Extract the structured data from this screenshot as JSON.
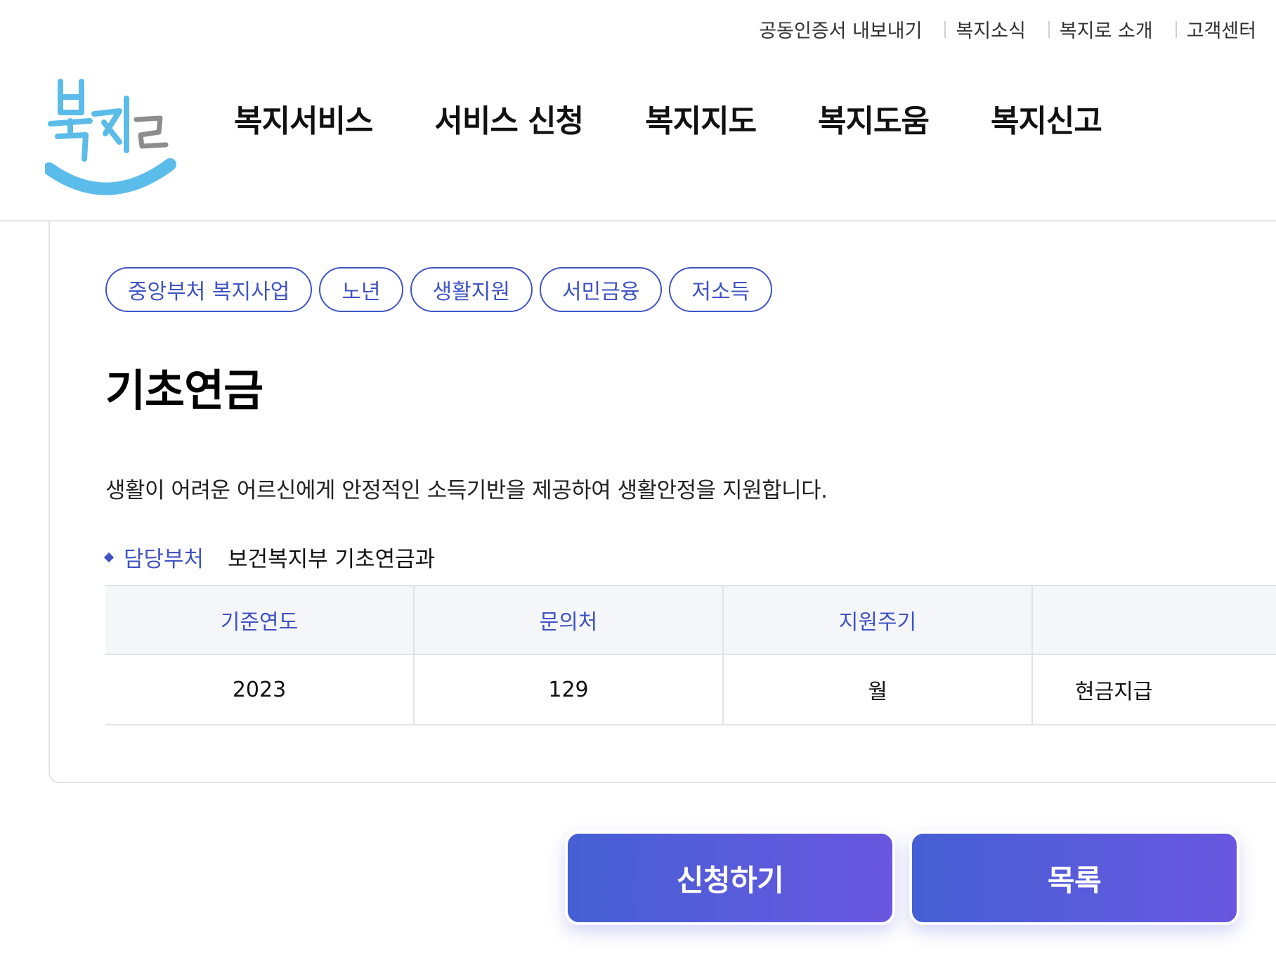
{
  "utility_nav": [
    {
      "label": "공동인증서 내보내기"
    },
    {
      "label": "복지소식"
    },
    {
      "label": "복지로 소개"
    },
    {
      "label": "고객센터"
    }
  ],
  "logo": {
    "alt": "복지로",
    "color_blue": "#5bbcea",
    "color_gray": "#8d8d8d"
  },
  "main_nav": [
    {
      "label": "복지서비스"
    },
    {
      "label": "서비스 신청"
    },
    {
      "label": "복지지도"
    },
    {
      "label": "복지도움"
    },
    {
      "label": "복지신고"
    }
  ],
  "tags": [
    "중앙부처 복지사업",
    "노년",
    "생활지원",
    "서민금융",
    "저소득"
  ],
  "service": {
    "title": "기초연금",
    "description": "생활이 어려운 어르신에게 안정적인 소득기반을 제공하여 생활안정을 지원합니다.",
    "department_label": "담당부처",
    "department_value": "보건복지부 기초연금과"
  },
  "info_table": {
    "headers": [
      "기준연도",
      "문의처",
      "지원주기",
      ""
    ],
    "values": [
      "2023",
      "129",
      "월",
      "현금지급"
    ]
  },
  "buttons": {
    "apply": "신청하기",
    "list": "목록"
  },
  "colors": {
    "accent": "#3f53c4",
    "button_gradient_start": "#4560d3",
    "button_gradient_end": "#6a57e1",
    "table_header_bg": "#f5f6fa"
  }
}
